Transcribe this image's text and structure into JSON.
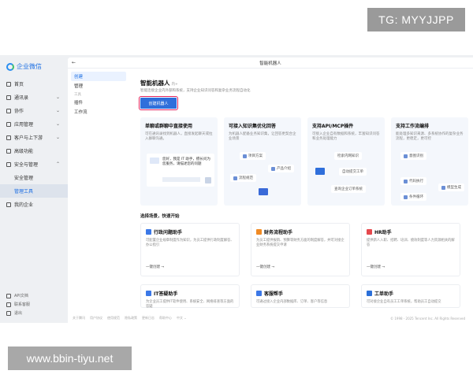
{
  "watermark_top": "TG: MYYJJPP",
  "watermark_bottom": "www.bbin-tiyu.net",
  "brand": "企业微信",
  "sidebar": {
    "items": [
      {
        "label": "首页"
      },
      {
        "label": "通讯录",
        "chev": "⌄"
      },
      {
        "label": "协作",
        "chev": "⌄"
      },
      {
        "label": "应用管理",
        "chev": "⌄"
      },
      {
        "label": "客户与上下游",
        "chev": "⌄"
      },
      {
        "label": "高级功能"
      },
      {
        "label": "安全与管理",
        "chev": "⌃"
      },
      {
        "label": "安全管理"
      },
      {
        "label": "管理工具"
      },
      {
        "label": "我的企业"
      }
    ],
    "footer": [
      "API文档",
      "联系客服",
      "退出"
    ]
  },
  "topbar": {
    "title": "智能机器人",
    "back": "←"
  },
  "subnav": [
    "创建",
    "管理",
    "工具",
    "插件",
    "工作流"
  ],
  "header": {
    "title": "智能机器人",
    "pro": "内+",
    "desc": "智能连接企业内外部和系统，支持企业知识问答和复杂业务流程自动化",
    "create_button": "创建机器人"
  },
  "features": [
    {
      "title": "单聊或群聊中直接使用",
      "desc": "可在通讯录找到机器人，直接发起聊天或拉入群聊沟通。",
      "chat": "您好，我是 IT 助手，擅长问为您服务，请描述您的问题"
    },
    {
      "title": "可接入知识集优化回答",
      "desc": "为机器人配备业务知识集，让回答更契合企业场景",
      "pills": [
        "项目方案",
        "产品介绍",
        "流程规范"
      ]
    },
    {
      "title": "支持API/MCP插件",
      "desc": "可接入企业自有数据和系统，丰富知识问答和业务处理能力",
      "pills": [
        "检索内网知识",
        "自动提交工单",
        "查询企业订单系统"
      ]
    },
    {
      "title": "支持工作流编排",
      "desc": "能处理多知识来源、多系统协作的复杂业务流程，更稳定，更可控",
      "pills": [
        "意图识别",
        "代码执行",
        "模型生成",
        "条件循环"
      ]
    }
  ],
  "section_title": "选择场景，快速开始",
  "templates": [
    {
      "title": "行政问题助手",
      "desc": "可配置企业规章制度作为知识，为员工提供行政制度解答、办公指引",
      "link": "一键创建 →",
      "color": "#3b78e7"
    },
    {
      "title": "财务流程助手",
      "desc": "为员工提供报销、预算等财务方面的制度解答，并可对接企业财务系统提交申请",
      "link": "一键创建 →",
      "color": "#f08a24"
    },
    {
      "title": "HR助手",
      "desc": "提供新人入职、招聘、培训、绩效制度等人力资源相关的解答",
      "link": "一键创建 →",
      "color": "#e5484d"
    },
    {
      "title": "IT答疑助手",
      "desc": "为企业员工提供IT软件使用、系统安全、网络排查等方面的答疑",
      "link": "",
      "color": "#3b78e7"
    },
    {
      "title": "客服帮手",
      "desc": "可通过接入企业内部数据库、订单、客户等信息",
      "link": "",
      "color": "#3b78e7"
    },
    {
      "title": "工单助手",
      "desc": "可对接企业自有员工工单系统，帮助员工自动提交",
      "link": "",
      "color": "#2b6fd8"
    }
  ],
  "footer": {
    "links": [
      "关于腾讯",
      "用户协议",
      "使用规范",
      "隐私政策",
      "更新日志",
      "帮助中心",
      "中文 ⌄"
    ],
    "copyright": "© 1998 - 2025 Tencent Inc. All Rights Reserved"
  }
}
